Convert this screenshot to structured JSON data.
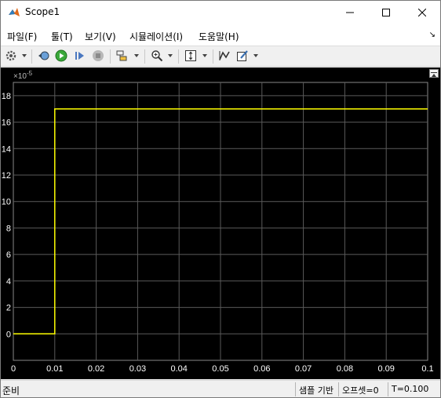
{
  "window": {
    "title": "Scope1"
  },
  "menu": [
    {
      "label": "파일(F)"
    },
    {
      "label": "툴(T)"
    },
    {
      "label": "보기(V)"
    },
    {
      "label": "시뮬레이션(I)"
    },
    {
      "label": "도움말(H)"
    }
  ],
  "toolbar": {
    "icons": [
      "settings-icon",
      "restore-icon",
      "run-icon",
      "step-forward-icon",
      "stop-icon",
      "highlight-block-icon",
      "zoom-icon",
      "autoscale-icon",
      "cursor-measure-icon",
      "edit-icon"
    ]
  },
  "chart_data": {
    "type": "line",
    "exponent_label": "×10",
    "exponent_power": "-5",
    "xlim": [
      0,
      0.1
    ],
    "ylim": [
      -2,
      19
    ],
    "x_ticks": [
      "0",
      "0.01",
      "0.02",
      "0.03",
      "0.04",
      "0.05",
      "0.06",
      "0.07",
      "0.08",
      "0.09",
      "0.1"
    ],
    "y_ticks": [
      "0",
      "2",
      "4",
      "6",
      "8",
      "10",
      "12",
      "14",
      "16",
      "18"
    ],
    "grid": true,
    "series": [
      {
        "color": "#ffff00",
        "x": [
          0,
          0.01,
          0.01,
          0.1
        ],
        "y": [
          0,
          0,
          17,
          17
        ]
      }
    ]
  },
  "colors": {
    "plot_bg": "#000000",
    "axes_bg": "#000000",
    "grid": "#5a5a5a",
    "trace": "#ffff00",
    "tick_text": "#ffffff"
  },
  "status": {
    "ready": "준비",
    "mode": "샘플 기반",
    "offset": "오프셋=0",
    "time": "T=0.100"
  }
}
